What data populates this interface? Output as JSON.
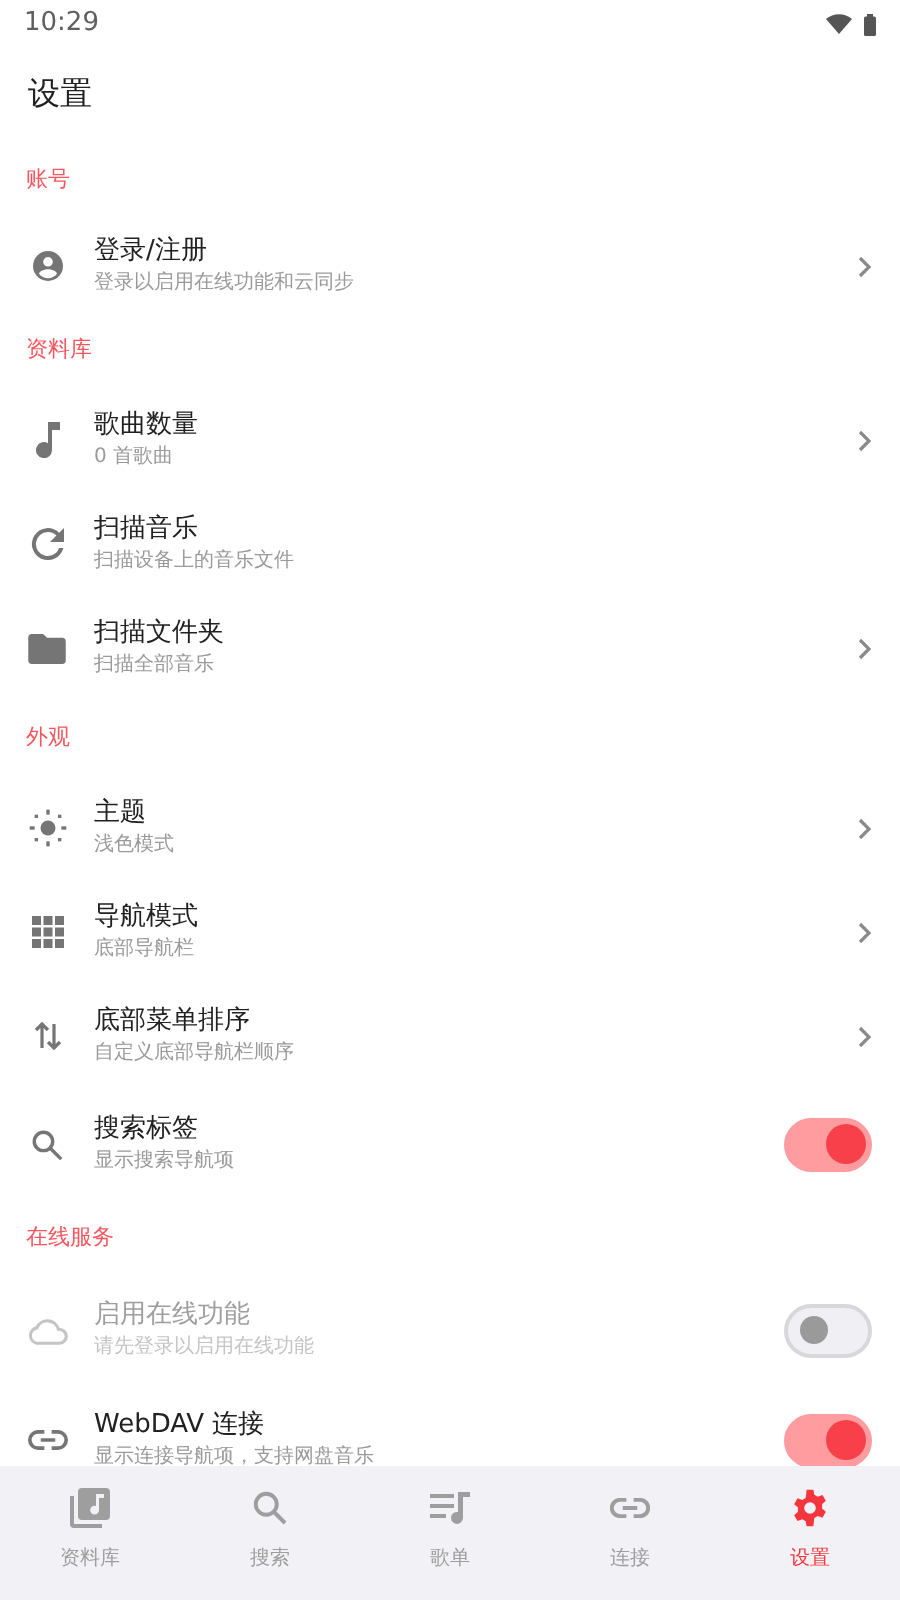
{
  "status_bar": {
    "time": "10:29"
  },
  "title": "设置",
  "sections": [
    {
      "header": "账号",
      "items": [
        {
          "kind": "link",
          "title": "登录/注册",
          "subtitle": "登录以启用在线功能和云同步",
          "disabled": false
        }
      ]
    },
    {
      "header": "资料库",
      "items": [
        {
          "kind": "link",
          "title": "歌曲数量",
          "subtitle": "0 首歌曲",
          "disabled": false
        },
        {
          "kind": "action",
          "title": "扫描音乐",
          "subtitle": "扫描设备上的音乐文件",
          "disabled": false
        },
        {
          "kind": "link",
          "title": "扫描文件夹",
          "subtitle": "扫描全部音乐",
          "disabled": false
        }
      ]
    },
    {
      "header": "外观",
      "items": [
        {
          "kind": "link",
          "title": "主题",
          "subtitle": "浅色模式",
          "disabled": false
        },
        {
          "kind": "link",
          "title": "导航模式",
          "subtitle": "底部导航栏",
          "disabled": false
        },
        {
          "kind": "link",
          "title": "底部菜单排序",
          "subtitle": "自定义底部导航栏顺序",
          "disabled": false
        },
        {
          "kind": "toggle",
          "title": "搜索标签",
          "subtitle": "显示搜索导航项",
          "on": true,
          "disabled": false
        }
      ]
    },
    {
      "header": "在线服务",
      "items": [
        {
          "kind": "toggle",
          "title": "启用在线功能",
          "subtitle": "请先登录以启用在线功能",
          "on": false,
          "disabled": true
        },
        {
          "kind": "toggle",
          "title": "WebDAV 连接",
          "subtitle": "显示连接导航项，支持网盘音乐",
          "on": true,
          "disabled": false
        }
      ]
    }
  ],
  "bottom_nav": [
    {
      "label": "资料库",
      "selected": false
    },
    {
      "label": "搜索",
      "selected": false
    },
    {
      "label": "歌单",
      "selected": false
    },
    {
      "label": "连接",
      "selected": false
    },
    {
      "label": "设置",
      "selected": true
    }
  ]
}
